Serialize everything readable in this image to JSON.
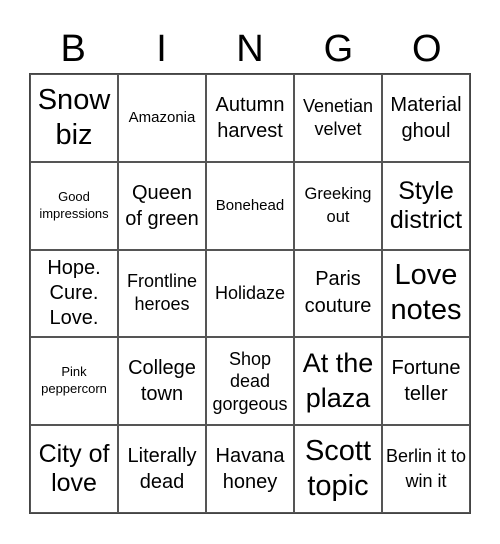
{
  "header": {
    "letters": [
      "B",
      "I",
      "N",
      "G",
      "O"
    ]
  },
  "board": {
    "rows": [
      [
        "Snow biz",
        "Amazonia",
        "Autumn harvest",
        "Venetian velvet",
        "Material ghoul"
      ],
      [
        "Good impressions",
        "Queen of green",
        "Bonehead",
        "Greeking out",
        "Style district"
      ],
      [
        "Hope. Cure. Love.",
        "Frontline heroes",
        "Holidaze",
        "Paris couture",
        "Love notes"
      ],
      [
        "Pink peppercorn",
        "College town",
        "Shop dead gorgeous",
        "At the plaza",
        "Fortune teller"
      ],
      [
        "City of love",
        "Literally dead",
        "Havana honey",
        "Scott topic",
        "Berlin it to win it"
      ]
    ]
  }
}
